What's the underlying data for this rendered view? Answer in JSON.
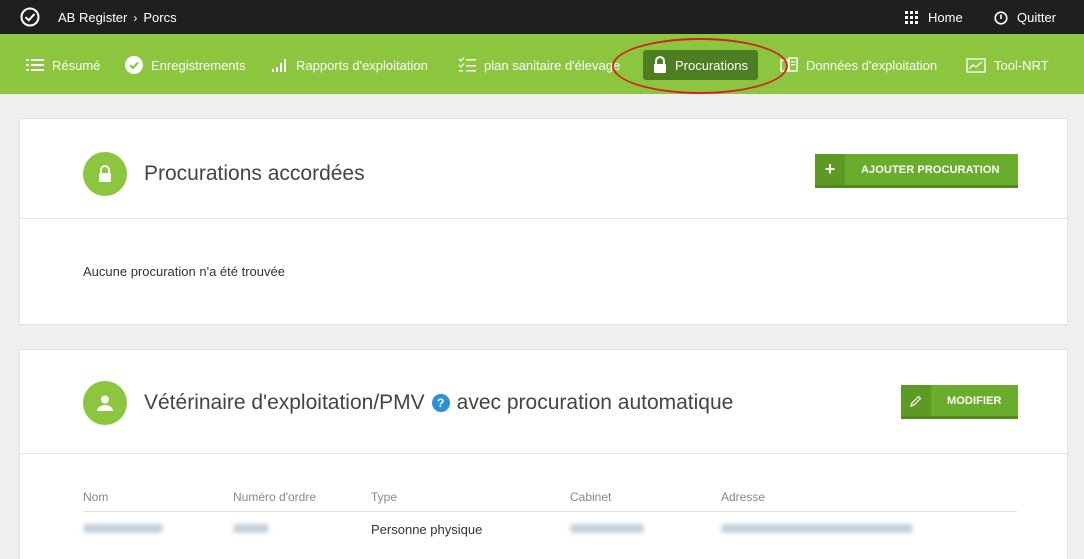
{
  "topbar": {
    "breadcrumb": [
      "AB Register",
      "Porcs"
    ],
    "separator": "›",
    "home_label": "Home",
    "quit_label": "Quitter"
  },
  "nav": {
    "items": [
      {
        "label": "Résumé",
        "icon": "list-icon"
      },
      {
        "label": "Enregistrements",
        "icon": "check-circle-icon"
      },
      {
        "label": "Rapports d'exploitation",
        "icon": "signal-bars-icon"
      },
      {
        "label": "plan sanitaire d'élevage",
        "icon": "checklist-icon"
      },
      {
        "label": "Procurations",
        "icon": "lock-icon",
        "active": true
      },
      {
        "label": "Données d'exploitation",
        "icon": "data-icon"
      },
      {
        "label": "Tool-NRT",
        "icon": "chart-icon"
      }
    ]
  },
  "section1": {
    "title": "Procurations accordées",
    "button_label": "AJOUTER PROCURATION",
    "button_icon": "+",
    "empty_message": "Aucune procuration n'a été trouvée"
  },
  "section2": {
    "title": "Vétérinaire d'exploitation/PMV",
    "help": "?",
    "title_suffix": "avec procuration automatique",
    "button_label": "MODIFIER",
    "columns": [
      "Nom",
      "Numéro d'ordre",
      "Type",
      "Cabinet",
      "Adresse"
    ],
    "row": {
      "type": "Personne physique"
    }
  },
  "colors": {
    "nav_green": "#8cc63f",
    "nav_active": "#4d7e22",
    "button_green": "#6aac2c",
    "topbar": "#1f1f1f",
    "annotation_red": "#d0261f"
  }
}
